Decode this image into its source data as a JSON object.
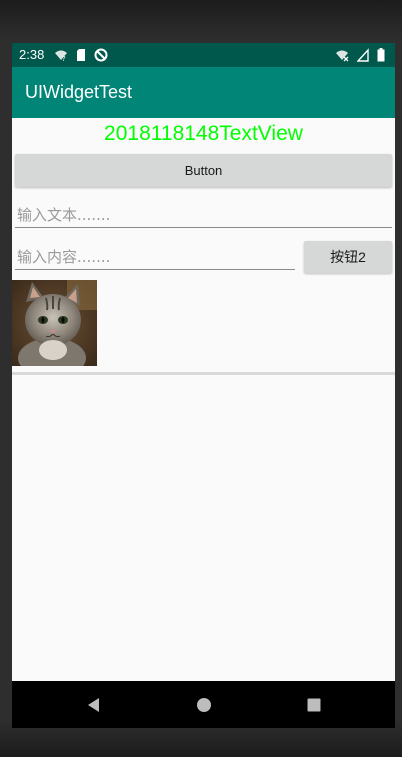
{
  "status_bar": {
    "time": "2:38",
    "icons_left": [
      "wifi-question-icon",
      "sd-card-icon",
      "sync-disabled-icon"
    ],
    "icons_right": [
      "wifi-off-icon",
      "signal-icon",
      "battery-icon"
    ]
  },
  "app_bar": {
    "title": "UIWidgetTest"
  },
  "main": {
    "text_view": "2018118148TextView",
    "button_label": "Button",
    "edit_text_1_placeholder": "输入文本.......",
    "edit_text_2_placeholder": "输入内容.......",
    "button2_label": "按钮2",
    "image_name": "kitten-photo"
  },
  "colors": {
    "status_bar": "#00574b",
    "app_bar": "#008577",
    "title_text": "#00ff00",
    "button": "#d6d7d7"
  },
  "nav_bar": {
    "icons": [
      "back-icon",
      "home-icon",
      "recent-apps-icon"
    ]
  }
}
